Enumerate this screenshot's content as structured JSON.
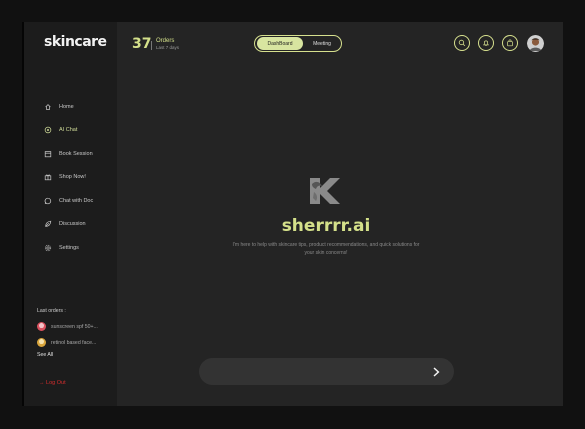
{
  "sidebar": {
    "logo": "skincare",
    "nav": [
      {
        "label": "Home",
        "icon": "home-icon"
      },
      {
        "label": "AI Chat",
        "icon": "ai-chat-icon"
      },
      {
        "label": "Book Session",
        "icon": "calendar-icon"
      },
      {
        "label": "Shop Now!",
        "icon": "gift-icon"
      },
      {
        "label": "Chat with Doc",
        "icon": "chat-bubble-icon"
      },
      {
        "label": "Discussion",
        "icon": "leaf-icon"
      },
      {
        "label": "Settings",
        "icon": "gear-icon"
      }
    ],
    "active_item": "AI Chat",
    "last_orders_label": "Last orders :",
    "orders": [
      {
        "label": "sunscreen spf 50+..."
      },
      {
        "label": "retinol based face..."
      }
    ],
    "see_all": "See All",
    "logout": "→ Log Out"
  },
  "header": {
    "count": "37",
    "count_title": "Orders",
    "count_sub": "Last 7 days",
    "toggle": {
      "active": "DashBoard",
      "inactive": "Meeting"
    },
    "icons": [
      "search-icon",
      "bell-icon",
      "bag-icon"
    ],
    "avatar": "avatar"
  },
  "main": {
    "brand_name": "sherrrr.ai",
    "description": "I'm here to help with skincare tips, product recommendations, and quick solutions for your skin concerns!"
  },
  "chat": {
    "placeholder": "",
    "send_icon": "chevron-right-icon"
  },
  "colors": {
    "accent": "#d4e08a",
    "background": "#242424",
    "sidebar": "#1c1c1c",
    "logout": "#d62d2d"
  }
}
